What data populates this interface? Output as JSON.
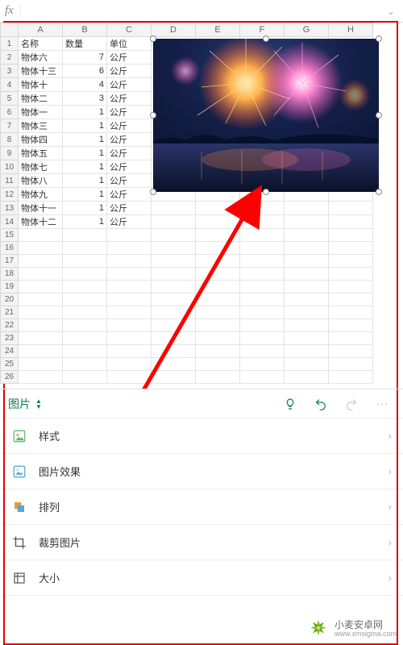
{
  "formula_bar": {
    "fx_label": "fx",
    "value": "",
    "expand_icon": "⌄"
  },
  "sheet": {
    "col_headers": [
      "A",
      "B",
      "C",
      "D",
      "E",
      "F",
      "G",
      "H"
    ],
    "header_row": {
      "name": "名称",
      "qty": "数量",
      "unit": "单位"
    },
    "rows": [
      {
        "name": "物体六",
        "qty": 7,
        "unit": "公斤"
      },
      {
        "name": "物体十三",
        "qty": 6,
        "unit": "公斤"
      },
      {
        "name": "物体十",
        "qty": 4,
        "unit": "公斤"
      },
      {
        "name": "物体二",
        "qty": 3,
        "unit": "公斤"
      },
      {
        "name": "物体一",
        "qty": 1,
        "unit": "公斤"
      },
      {
        "name": "物体三",
        "qty": 1,
        "unit": "公斤"
      },
      {
        "name": "物体四",
        "qty": 1,
        "unit": "公斤"
      },
      {
        "name": "物体五",
        "qty": 1,
        "unit": "公斤"
      },
      {
        "name": "物体七",
        "qty": 1,
        "unit": "公斤"
      },
      {
        "name": "物体八",
        "qty": 1,
        "unit": "公斤"
      },
      {
        "name": "物体九",
        "qty": 1,
        "unit": "公斤"
      },
      {
        "name": "物体十一",
        "qty": 1,
        "unit": "公斤"
      },
      {
        "name": "物体十二",
        "qty": 1,
        "unit": "公斤"
      }
    ],
    "blank_rows": 12,
    "image": {
      "alt": "fireworks-photo"
    }
  },
  "context_bar": {
    "title": "图片",
    "hint_icon": "lightbulb-icon",
    "undo_icon": "undo-icon",
    "redo_icon": "redo-icon"
  },
  "menu": {
    "items": [
      {
        "key": "style",
        "label": "样式",
        "icon": "style-icon"
      },
      {
        "key": "effects",
        "label": "图片效果",
        "icon": "effects-icon"
      },
      {
        "key": "arrange",
        "label": "排列",
        "icon": "arrange-icon"
      },
      {
        "key": "crop",
        "label": "裁剪图片",
        "icon": "crop-icon"
      },
      {
        "key": "size",
        "label": "大小",
        "icon": "size-icon"
      }
    ]
  },
  "watermark": {
    "site_name": "小麦安卓网",
    "site_url": "www.xmsigma.com"
  },
  "colors": {
    "brand_green": "#0f7b4b",
    "frame_red": "#e00000",
    "arrow_red": "#ff0000"
  }
}
